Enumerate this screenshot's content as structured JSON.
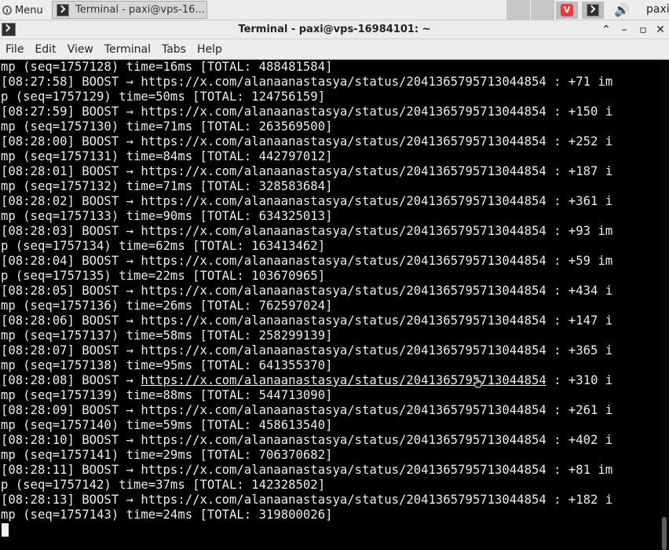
{
  "taskbar": {
    "menu_label": "Menu",
    "task_title": "Terminal - paxi@vps-16...",
    "user_label": "paxi",
    "vivaldi_glyph": "V",
    "volume_glyph": "🔊"
  },
  "window": {
    "title": "Terminal - paxi@vps-16984101: ~",
    "btn_up": "⌃",
    "btn_min": "–",
    "btn_max": "▫",
    "btn_close": "✕"
  },
  "menubar": [
    "File",
    "Edit",
    "View",
    "Terminal",
    "Tabs",
    "Help"
  ],
  "terminal": {
    "lines": [
      "mp (seq=1757128) time=16ms [TOTAL: 488481584]",
      "[08:27:58] BOOST → https://x.com/alanaanastasya/status/2041365795713044854 : +71 im",
      "p (seq=1757129) time=50ms [TOTAL: 124756159]",
      "[08:27:59] BOOST → https://x.com/alanaanastasya/status/2041365795713044854 : +150 i",
      "mp (seq=1757130) time=71ms [TOTAL: 263569500]",
      "[08:28:00] BOOST → https://x.com/alanaanastasya/status/2041365795713044854 : +252 i",
      "mp (seq=1757131) time=84ms [TOTAL: 442797012]",
      "[08:28:01] BOOST → https://x.com/alanaanastasya/status/2041365795713044854 : +187 i",
      "mp (seq=1757132) time=71ms [TOTAL: 328583684]",
      "[08:28:02] BOOST → https://x.com/alanaanastasya/status/2041365795713044854 : +361 i",
      "mp (seq=1757133) time=90ms [TOTAL: 634325013]",
      "[08:28:03] BOOST → https://x.com/alanaanastasya/status/2041365795713044854 : +93 im",
      "p (seq=1757134) time=62ms [TOTAL: 163413462]",
      "[08:28:04] BOOST → https://x.com/alanaanastasya/status/2041365795713044854 : +59 im",
      "p (seq=1757135) time=22ms [TOTAL: 103670965]",
      "[08:28:05] BOOST → https://x.com/alanaanastasya/status/2041365795713044854 : +434 i",
      "mp (seq=1757136) time=26ms [TOTAL: 762597024]",
      "[08:28:06] BOOST → https://x.com/alanaanastasya/status/2041365795713044854 : +147 i",
      "mp (seq=1757137) time=58ms [TOTAL: 258299139]",
      "[08:28:07] BOOST → https://x.com/alanaanastasya/status/2041365795713044854 : +365 i",
      "mp (seq=1757138) time=95ms [TOTAL: 641355370]",
      "[08:28:08] BOOST → https://x.com/alanaanastasya/status/2041365795713044854 : +310 i",
      "mp (seq=1757139) time=88ms [TOTAL: 544713090]",
      "[08:28:09] BOOST → https://x.com/alanaanastasya/status/2041365795713044854 : +261 i",
      "mp (seq=1757140) time=59ms [TOTAL: 458613540]",
      "[08:28:10] BOOST → https://x.com/alanaanastasya/status/2041365795713044854 : +402 i",
      "mp (seq=1757141) time=29ms [TOTAL: 706370682]",
      "[08:28:11] BOOST → https://x.com/alanaanastasya/status/2041365795713044854 : +81 im",
      "p (seq=1757142) time=37ms [TOTAL: 142328502]",
      "[08:28:13] BOOST → https://x.com/alanaanastasya/status/2041365795713044854 : +182 i",
      "mp (seq=1757143) time=24ms [TOTAL: 319800026]"
    ],
    "hovered_line_index": 21,
    "hovered_url": "https://x.com/alanaanastasya/status/2041365795713044854",
    "foreground": "#ececec",
    "background": "#000000"
  }
}
